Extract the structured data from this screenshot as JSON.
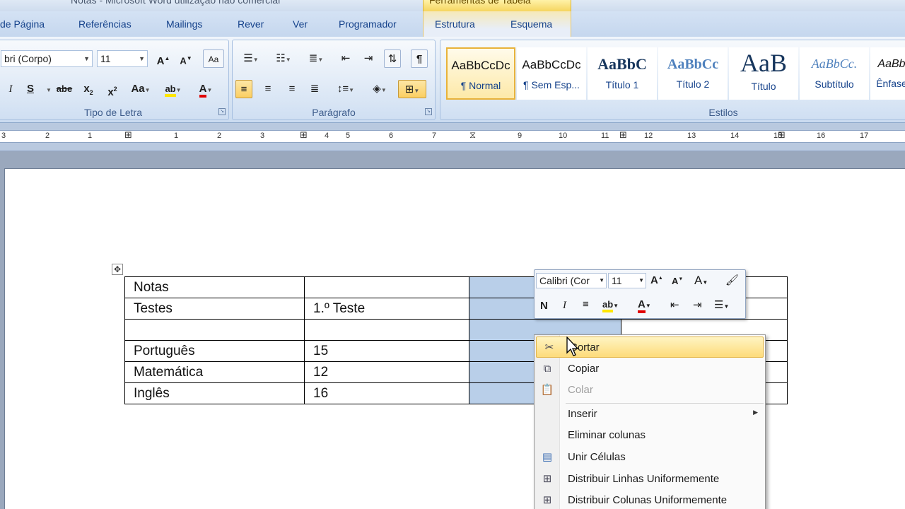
{
  "window": {
    "title": "Notas - Microsoft Word utilização não comercial",
    "context_title": "Ferramentas de Tabela"
  },
  "tabs": [
    "de Página",
    "Referências",
    "Mailings",
    "Rever",
    "Ver",
    "Programador",
    "Estrutura",
    "Esquema"
  ],
  "ribbon": {
    "font_group": {
      "label": "Tipo de Letra",
      "font_name": "bri (Corpo)",
      "font_size": "11"
    },
    "paragraph_group": {
      "label": "Parágrafo"
    },
    "styles_group": {
      "label": "Estilos",
      "styles": [
        {
          "sample": "AaBbCcDc",
          "name": "¶ Normal"
        },
        {
          "sample": "AaBbCcDc",
          "name": "¶ Sem Esp..."
        },
        {
          "sample": "AaBbC",
          "name": "Título 1"
        },
        {
          "sample": "AaBbCc",
          "name": "Título 2"
        },
        {
          "sample": "AaB",
          "name": "Título"
        },
        {
          "sample": "AaBbCc.",
          "name": "Subtítulo"
        },
        {
          "sample": "AaBb",
          "name": "Ênfase"
        }
      ]
    }
  },
  "ruler": {
    "numbers": [
      "3",
      "2",
      "1",
      "1",
      "2",
      "3",
      "4",
      "5",
      "6",
      "7",
      "9",
      "10",
      "11",
      "12",
      "13",
      "14",
      "15",
      "16",
      "17"
    ]
  },
  "table": {
    "rows": [
      [
        "Notas",
        "",
        "",
        ""
      ],
      [
        "Testes",
        "1.º Teste",
        "",
        ""
      ],
      [
        "",
        "",
        "",
        ""
      ],
      [
        "Português",
        "15",
        "",
        ""
      ],
      [
        "Matemática",
        "12",
        "",
        ""
      ],
      [
        "Inglês",
        "16",
        "",
        ""
      ]
    ]
  },
  "mini_toolbar": {
    "font_name": "Calibri (Cor",
    "font_size": "11",
    "bold": "N",
    "italic": "I"
  },
  "context_menu": {
    "items": [
      {
        "label": "Cortar",
        "icon": "scissors-icon",
        "highlighted": true
      },
      {
        "label": "Copiar",
        "icon": "copy-icon"
      },
      {
        "label": "Colar",
        "icon": "paste-icon",
        "disabled": true
      },
      {
        "label": "Inserir",
        "submenu": true
      },
      {
        "label": "Eliminar colunas"
      },
      {
        "label": "Unir Células",
        "icon": "merge-cells-icon"
      },
      {
        "label": "Distribuir Linhas Uniformemente",
        "icon": "distribute-rows-icon"
      },
      {
        "label": "Distribuir Colunas Uniformemente",
        "icon": "distribute-columns-icon"
      }
    ]
  }
}
